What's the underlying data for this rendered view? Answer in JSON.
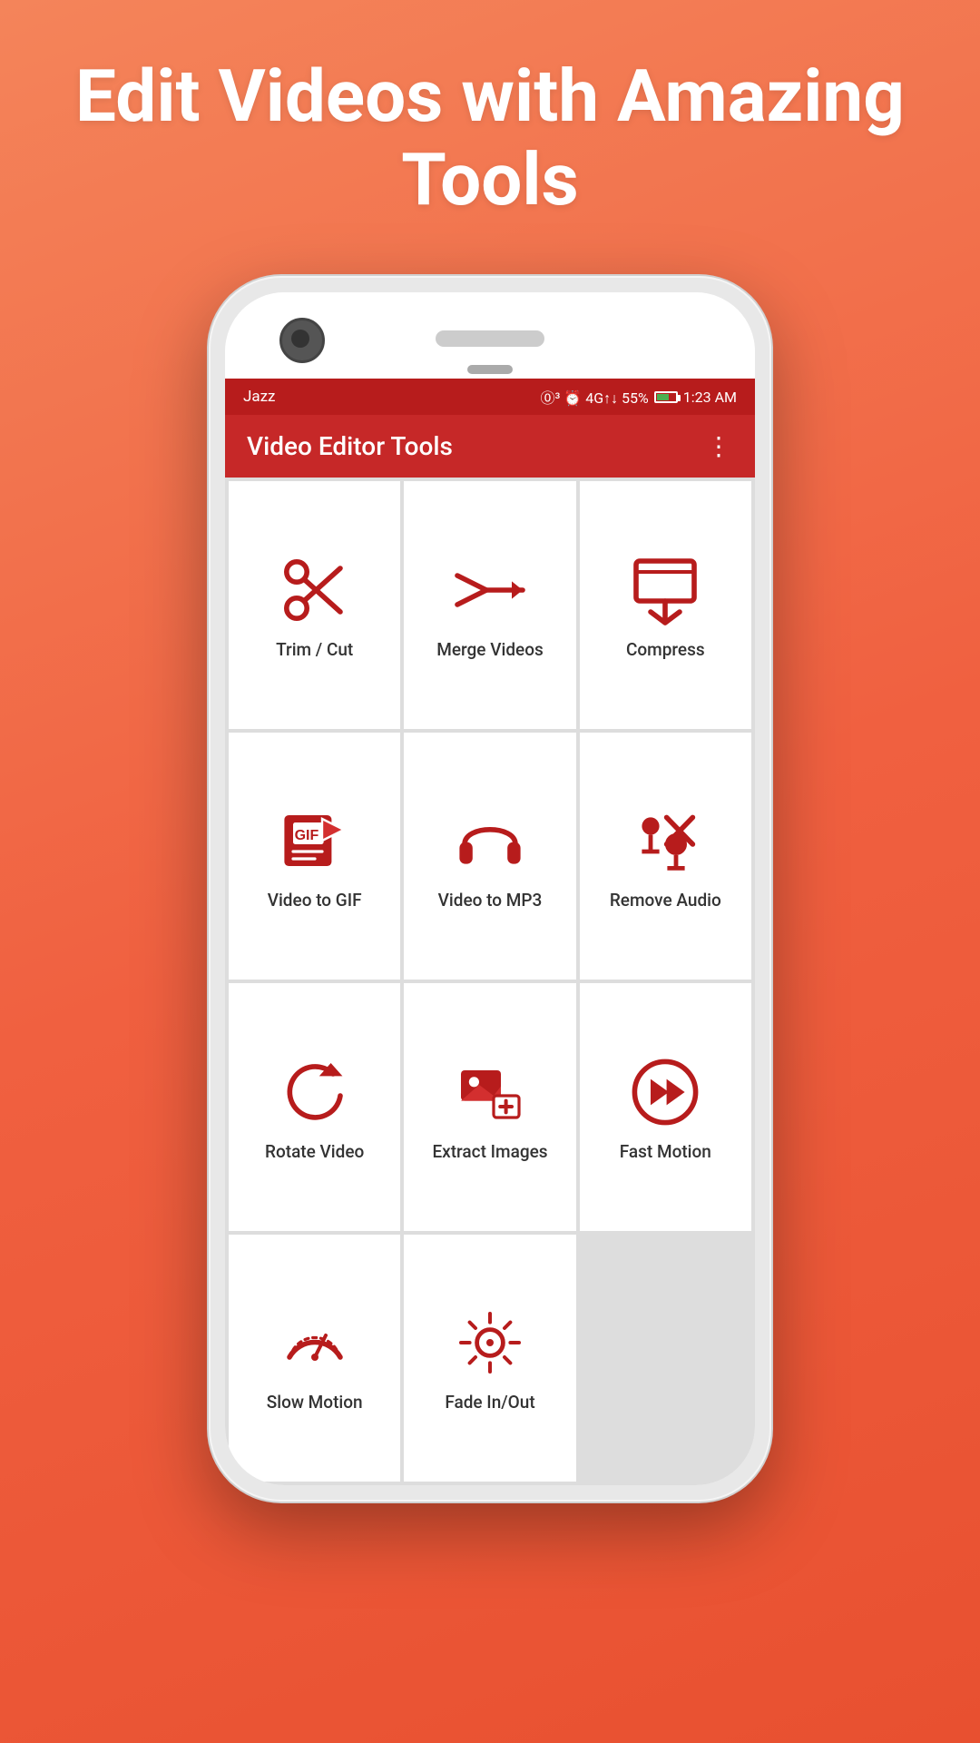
{
  "hero": {
    "title": "Edit Videos with Amazing Tools"
  },
  "statusBar": {
    "carrier": "Jazz",
    "icons": "⌀³ ⏰ 4G",
    "battery": "55%",
    "time": "1:23 AM"
  },
  "appBar": {
    "title": "Video Editor Tools",
    "menuLabel": "⋮"
  },
  "tools": [
    {
      "id": "trim-cut",
      "label": "Trim / Cut",
      "icon": "scissors"
    },
    {
      "id": "merge-videos",
      "label": "Merge Videos",
      "icon": "merge"
    },
    {
      "id": "compress",
      "label": "Compress",
      "icon": "compress"
    },
    {
      "id": "video-to-gif",
      "label": "Video to GIF",
      "icon": "gif"
    },
    {
      "id": "video-to-mp3",
      "label": "Video to MP3",
      "icon": "headphones"
    },
    {
      "id": "remove-audio",
      "label": "Remove Audio",
      "icon": "remove-audio"
    },
    {
      "id": "rotate-video",
      "label": "Rotate Video",
      "icon": "rotate"
    },
    {
      "id": "extract-images",
      "label": "Extract Images",
      "icon": "extract"
    },
    {
      "id": "fast-motion",
      "label": "Fast Motion",
      "icon": "fast-forward"
    },
    {
      "id": "slow-motion",
      "label": "Slow Motion",
      "icon": "speedometer"
    },
    {
      "id": "fade-in-out",
      "label": "Fade In/Out",
      "icon": "sun"
    }
  ],
  "colors": {
    "brand": "#c62828",
    "icon": "#b71c1c"
  }
}
